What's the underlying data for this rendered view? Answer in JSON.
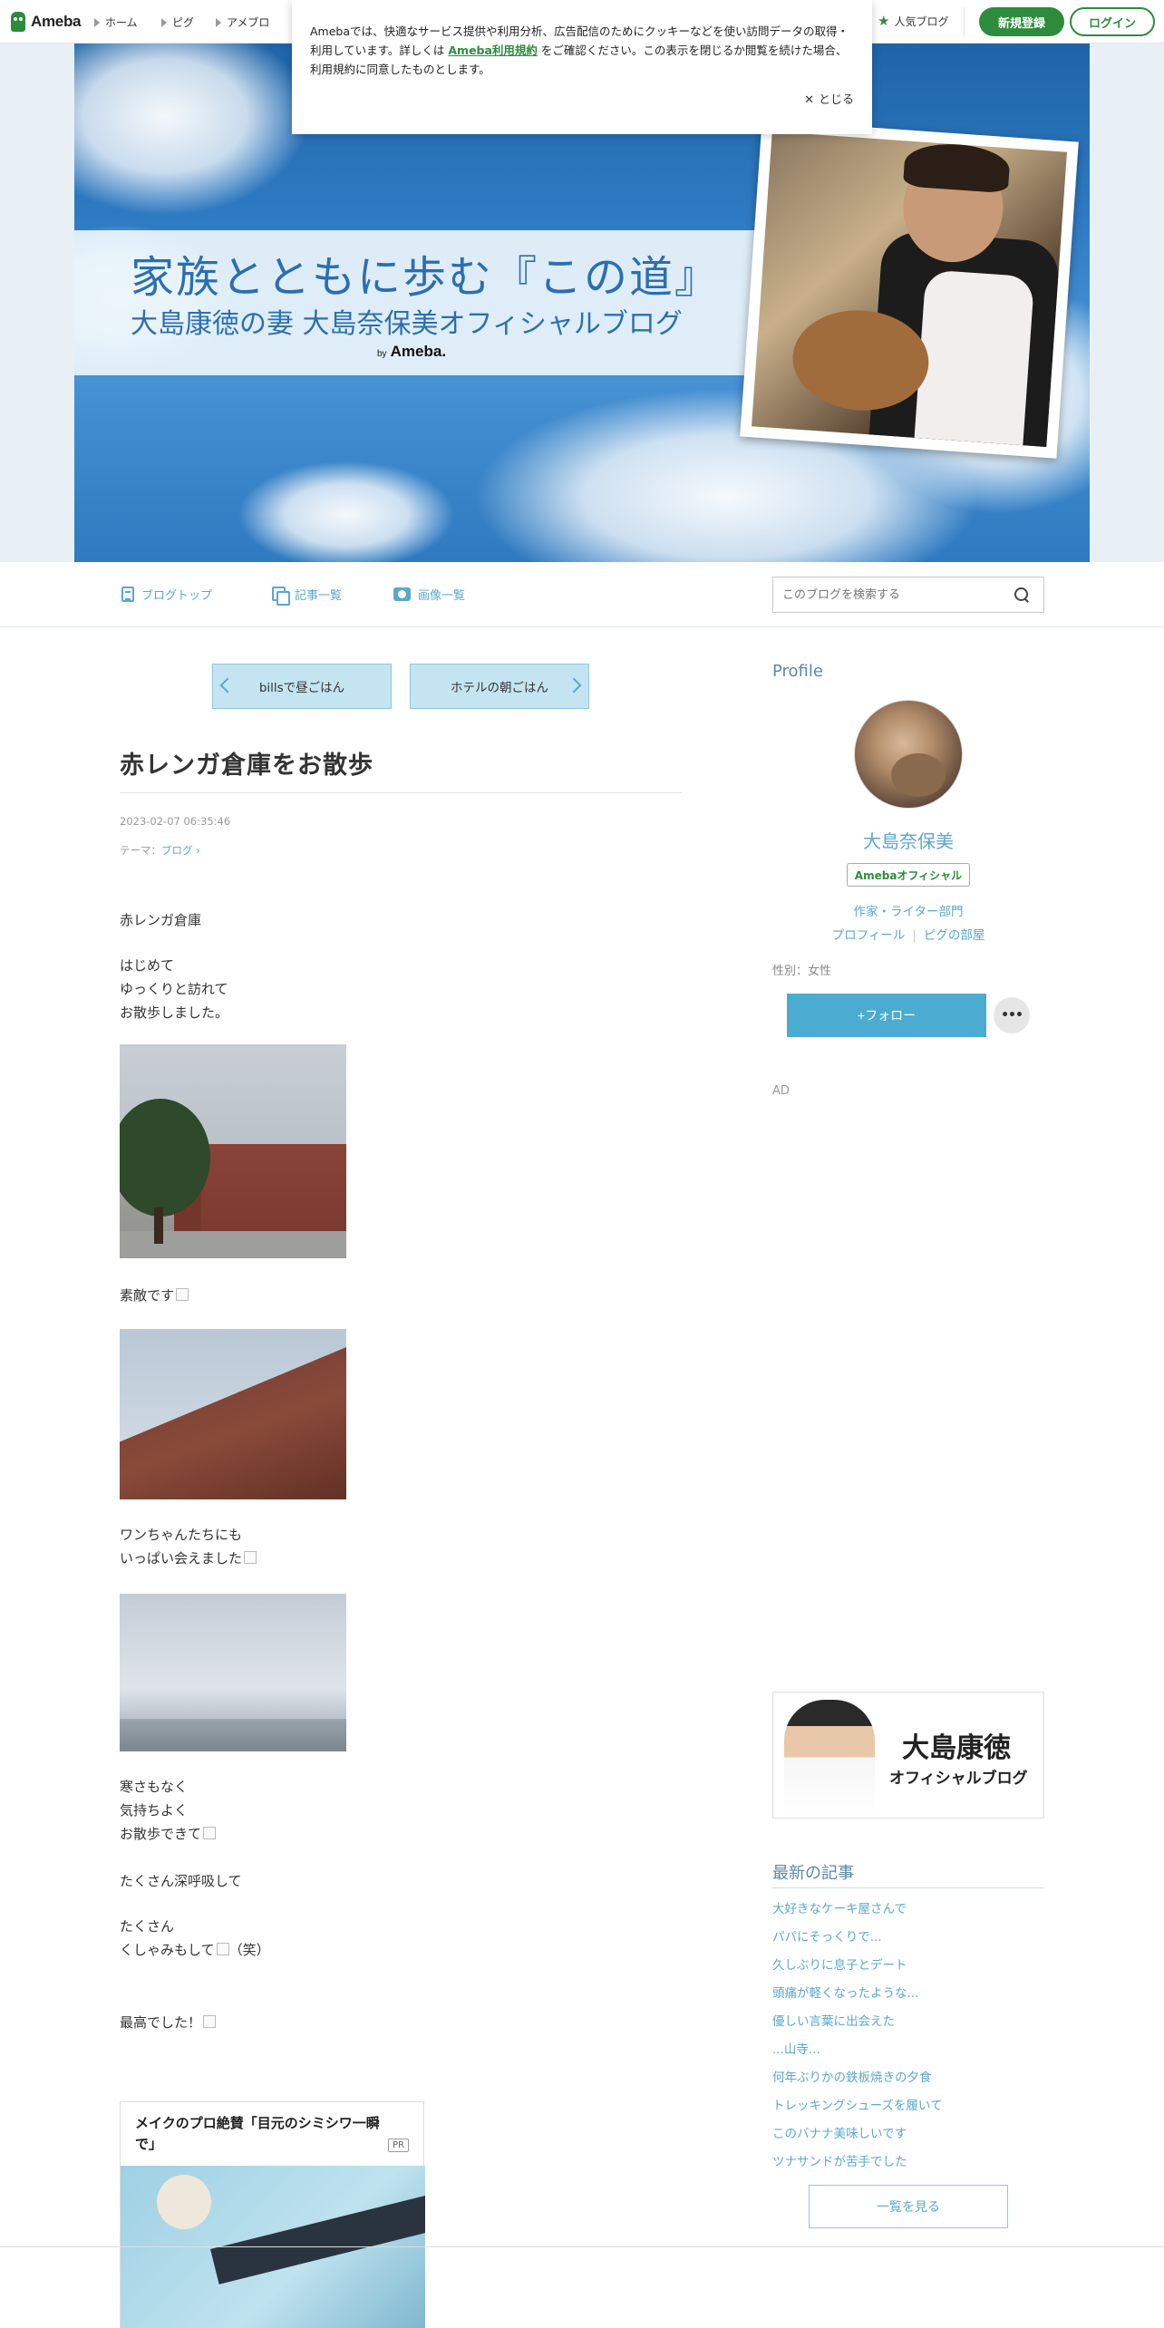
{
  "global_header": {
    "logo_text": "Ameba",
    "nav": [
      "ホーム",
      "ピグ",
      "アメブロ"
    ],
    "popular_blog": "人気ブログ",
    "signup": "新規登録",
    "login": "ログイン",
    "brand_color": "#2d8c3c"
  },
  "cookie_notice": {
    "text_before": "Amebaでは、快適なサービス提供や利用分析、広告配信のためにクッキーなどを使い訪問データの取得・利用しています。詳しくは",
    "link": "Ameba利用規約",
    "text_after": "をご確認ください。この表示を閉じるか閲覧を続けた場合、利用規約に同意したものとします。",
    "close": "とじる"
  },
  "banner": {
    "title": "家族とともに歩む『この道』",
    "subtitle": "大島康徳の妻 大島奈保美オフィシャルブログ",
    "by": "by",
    "brand": "Ameba."
  },
  "blog_nav": {
    "items": [
      "ブログトップ",
      "記事一覧",
      "画像一覧"
    ],
    "search_placeholder": "このブログを検索する"
  },
  "pager": {
    "prev": "billsで昼ごはん",
    "next": "ホテルの朝ごはん"
  },
  "article": {
    "title": "赤レンガ倉庫をお散歩",
    "date": "2023-02-07 06:35:46",
    "theme_label": "テーマ：",
    "theme": "ブログ",
    "p1": [
      "赤レンガ倉庫"
    ],
    "p2": [
      "はじめて",
      "ゆっくりと訪れて",
      "お散歩しました。"
    ],
    "p3": "素敵です",
    "p4": [
      "ワンちゃんたちにも",
      "いっぱい会えました"
    ],
    "p5": [
      "寒さもなく",
      "気持ちよく",
      "お散歩できて"
    ],
    "p6": "たくさん深呼吸して",
    "p7": [
      "たくさん",
      "くしゃみもして",
      "（笑）"
    ],
    "p8": "最高でした！"
  },
  "pr_card": {
    "title": "メイクのプロ絶賛「目元のシミシワ一瞬で」",
    "badge": "PR"
  },
  "sidebar": {
    "profile_heading": "Profile",
    "name": "大島奈保美",
    "badge": "Amebaオフィシャル",
    "category": "作家・ライター部門",
    "links": [
      "プロフィール",
      "ピグの部屋"
    ],
    "gender": "性別：女性",
    "follow": "+フォロー",
    "more": "•••",
    "ad": "AD",
    "banner_name": "大島康徳",
    "banner_sub": "オフィシャルブログ",
    "latest_heading": "最新の記事",
    "latest": [
      "大好きなケーキ屋さんで",
      "パパにそっくりで...",
      "久しぶりに息子とデート",
      "頭痛が軽くなったような...",
      "優しい言葉に出会えた",
      "...山寺...",
      "何年ぶりかの鉄板焼きの夕食",
      "トレッキングシューズを履いて",
      "このバナナ美味しいです",
      "ツナサンドが苦手でした"
    ],
    "see_all": "一覧を見る",
    "accent_color": "#5aa8cc"
  }
}
